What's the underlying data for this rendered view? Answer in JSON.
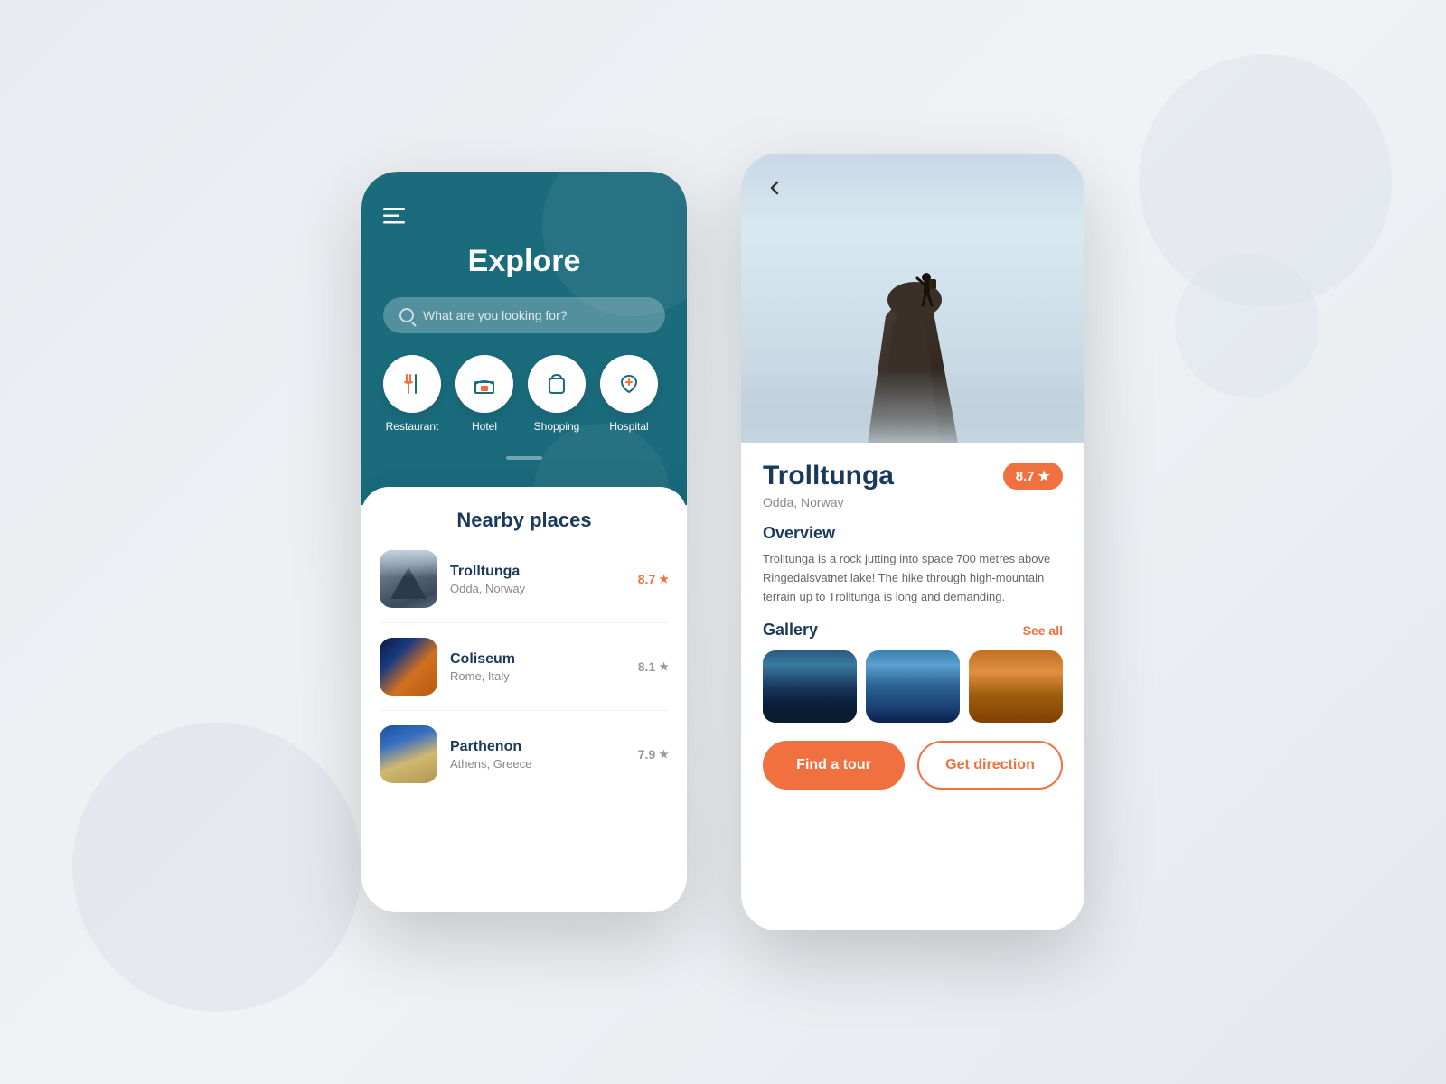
{
  "background": {
    "color": "#eef0f4"
  },
  "phone1": {
    "header": {
      "title": "Explore",
      "search_placeholder": "What are you looking for?"
    },
    "categories": [
      {
        "id": "restaurant",
        "label": "Restaurant",
        "icon": "✕✕"
      },
      {
        "id": "hotel",
        "label": "Hotel",
        "icon": "🛏"
      },
      {
        "id": "shopping",
        "label": "Shopping",
        "icon": "🛍"
      },
      {
        "id": "hospital",
        "label": "Hospital",
        "icon": "♡"
      }
    ],
    "nearby_section": {
      "title": "Nearby places",
      "places": [
        {
          "name": "Trolltunga",
          "location": "Odda, Norway",
          "rating": "8.7",
          "rating_color": "orange"
        },
        {
          "name": "Coliseum",
          "location": "Rome, Italy",
          "rating": "8.1",
          "rating_color": "gray"
        },
        {
          "name": "Parthenon",
          "location": "Athens, Greece",
          "rating": "7.9",
          "rating_color": "gray"
        }
      ]
    }
  },
  "phone2": {
    "back_button": "‹",
    "place_name": "Trolltunga",
    "place_location": "Odda, Norway",
    "rating": "8.7",
    "rating_star": "★",
    "overview": {
      "title": "Overview",
      "text": "Trolltunga is a rock jutting into space 700 metres above Ringedalsvatnet lake! The hike through high-mountain terrain up to Trolltunga is long and demanding."
    },
    "gallery": {
      "title": "Gallery",
      "see_all": "See all"
    },
    "buttons": {
      "find_tour": "Find a tour",
      "get_direction": "Get direction"
    }
  }
}
